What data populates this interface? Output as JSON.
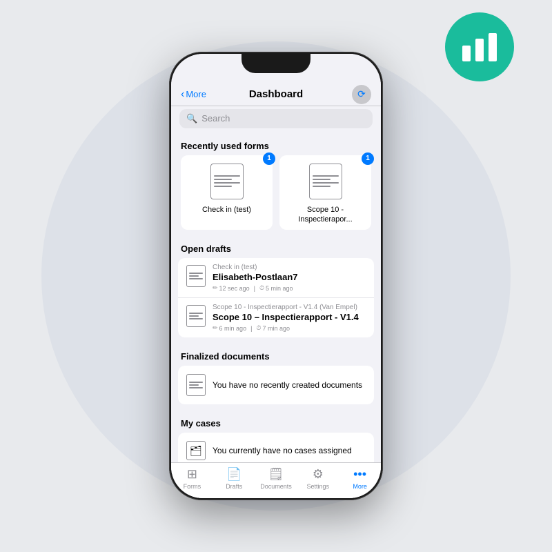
{
  "background": {
    "circle_color": "#dde1e8"
  },
  "stats_badge": {
    "color": "#1abc9c",
    "icon": "chart-bars"
  },
  "nav": {
    "back_label": "More",
    "title": "Dashboard",
    "icon": "cloud-sync"
  },
  "search": {
    "placeholder": "Search"
  },
  "recently_used": {
    "header": "Recently used forms",
    "forms": [
      {
        "label": "Check in (test)",
        "badge": "1"
      },
      {
        "label": "Scope 10 - Inspectierapor...",
        "badge": "1"
      }
    ]
  },
  "open_drafts": {
    "header": "Open drafts",
    "items": [
      {
        "subtitle": "Check in (test)",
        "title": "Elisabeth-Postlaan7",
        "meta1": "12 sec ago",
        "meta2": "5 min ago"
      },
      {
        "subtitle": "Scope 10 - Inspectierapport - V1.4 (Van Empel)",
        "title": "Scope 10 – Inspectierapport - V1.4",
        "meta1": "6 min ago",
        "meta2": "7 min ago"
      }
    ]
  },
  "finalized": {
    "header": "Finalized documents",
    "empty_text": "You have no recently created documents"
  },
  "my_cases": {
    "header": "My cases",
    "empty_text": "You currently have no cases assigned"
  },
  "tabs": [
    {
      "label": "Forms",
      "icon": "forms",
      "active": false
    },
    {
      "label": "Drafts",
      "icon": "drafts",
      "active": false
    },
    {
      "label": "Documents",
      "icon": "documents",
      "active": false
    },
    {
      "label": "Settings",
      "icon": "settings",
      "active": false
    },
    {
      "label": "More",
      "icon": "more",
      "active": true
    }
  ]
}
